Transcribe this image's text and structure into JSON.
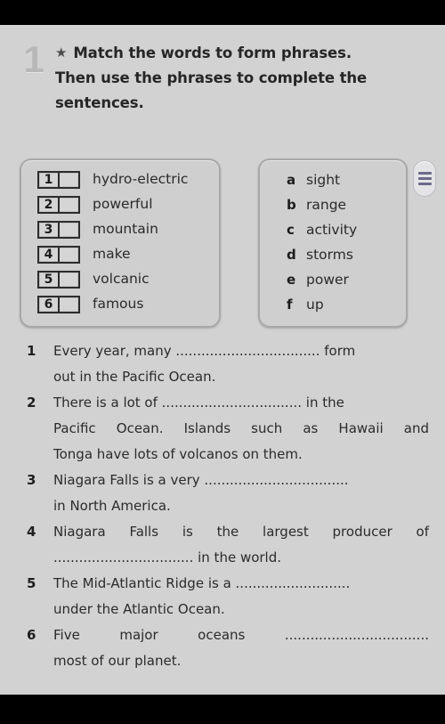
{
  "exercise": {
    "number": "1",
    "star_icon": "★",
    "heading_lines": [
      "Match the words to form phrases.",
      "Then use the phrases to complete the",
      "sentences."
    ]
  },
  "match_left": {
    "items": [
      {
        "number": "1",
        "word": "hydro-electric",
        "answer": ""
      },
      {
        "number": "2",
        "word": "powerful",
        "answer": ""
      },
      {
        "number": "3",
        "word": "mountain",
        "answer": ""
      },
      {
        "number": "4",
        "word": "make",
        "answer": ""
      },
      {
        "number": "5",
        "word": "volcanic",
        "answer": ""
      },
      {
        "number": "6",
        "word": "famous",
        "answer": ""
      }
    ]
  },
  "match_right": {
    "items": [
      {
        "letter": "a",
        "word": "sight"
      },
      {
        "letter": "b",
        "word": "range"
      },
      {
        "letter": "c",
        "word": "activity"
      },
      {
        "letter": "d",
        "word": "storms"
      },
      {
        "letter": "e",
        "word": "power"
      },
      {
        "letter": "f",
        "word": "up"
      }
    ]
  },
  "menu_button": {
    "icon": "hamburger-icon",
    "bar_color": "#6b6a8c"
  },
  "sentences": [
    {
      "number": "1",
      "lines": [
        "Every year, many .................................. form",
        "out in the Pacific Ocean."
      ]
    },
    {
      "number": "2",
      "lines": [
        "There is a lot of ................................. in the",
        "Pacific Ocean. Islands such as Hawaii and",
        "Tonga have lots of volcanos on them."
      ]
    },
    {
      "number": "3",
      "lines": [
        "Niagara Falls is a very ..................................",
        "in North America."
      ]
    },
    {
      "number": "4",
      "lines": [
        "Niagara Falls is the largest producer of",
        "................................. in the world."
      ]
    },
    {
      "number": "5",
      "lines": [
        "The Mid-Atlantic Ridge is a ...........................",
        "under the Atlantic Ocean."
      ]
    },
    {
      "number": "6",
      "lines": [
        "Five major oceans ..................................",
        "most of our planet."
      ]
    }
  ],
  "colors": {
    "page_background": "#d2d2d2",
    "panel_background": "#cfcfcf",
    "panel_border": "#a8a8a8",
    "text": "#2b2b2b",
    "number_grey": "#b8b8b8"
  }
}
